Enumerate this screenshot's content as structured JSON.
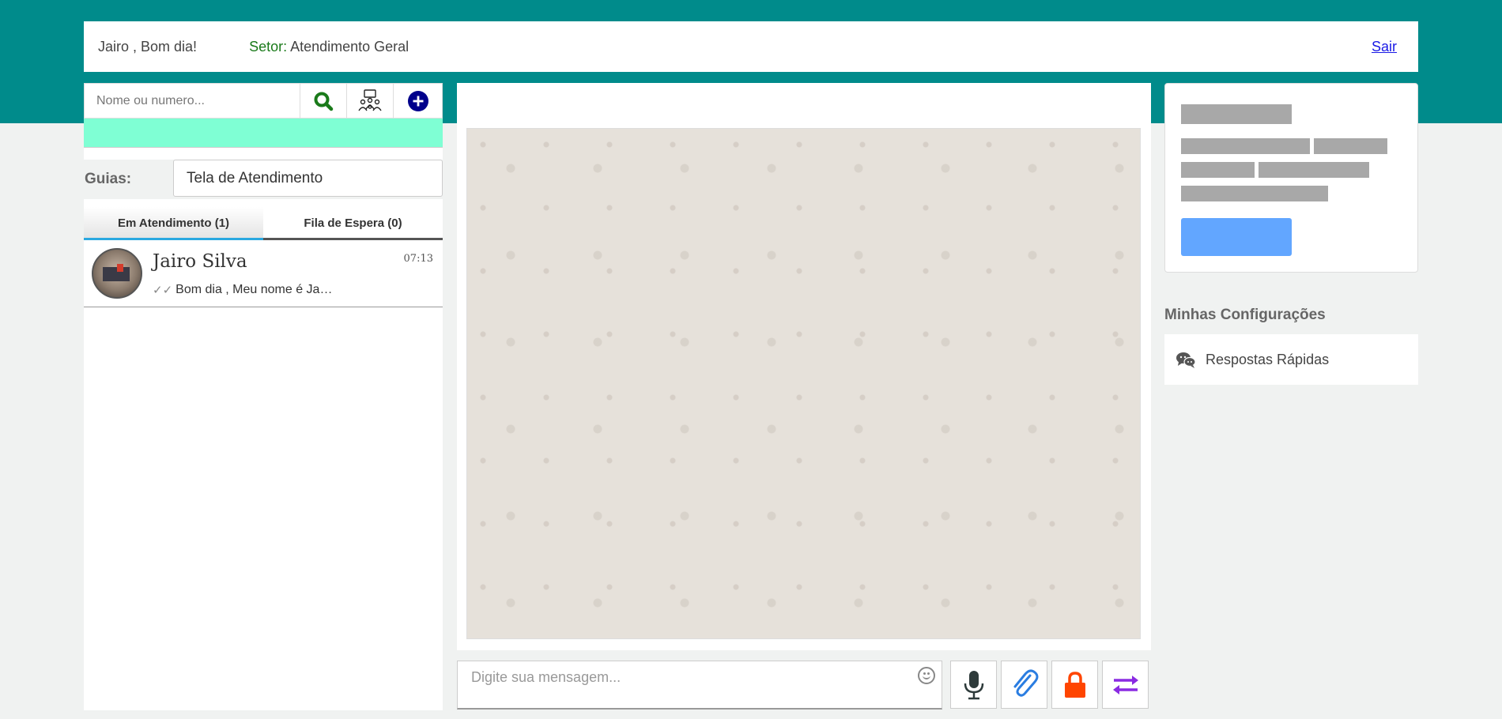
{
  "header": {
    "greeting": "Jairo , Bom dia!",
    "setor_label": "Setor:",
    "setor_value": " Atendimento Geral",
    "logout_label": "Sair"
  },
  "search": {
    "placeholder": "Nome ou numero...",
    "icons": [
      "search-icon",
      "group-icon",
      "add-icon"
    ]
  },
  "guias": {
    "label": "Guias:",
    "selected": "Tela de Atendimento"
  },
  "tabs": [
    {
      "label": "Em Atendimento (1)",
      "active": true
    },
    {
      "label": "Fila de Espera (0)",
      "active": false
    }
  ],
  "chats": [
    {
      "name": "Jairo Silva",
      "time": "07:13",
      "ticks": "✓✓",
      "preview": "Bom dia , Meu nome é Ja…"
    }
  ],
  "composer": {
    "placeholder": "Digite sua mensagem...",
    "actions": [
      "microphone-icon",
      "paperclip-icon",
      "lock-icon",
      "transfer-icon"
    ]
  },
  "sidebar_right": {
    "config_title": "Minhas Configurações",
    "config_items": [
      {
        "label": "Respostas Rápidas",
        "icon": "chat-bubbles-icon"
      }
    ]
  },
  "colors": {
    "brand": "#008b8b",
    "notice": "#7fffd4",
    "tab_active": "#29a8e0",
    "primary_button": "#62a6ff",
    "lock": "#ff4500",
    "transfer": "#8a2be2",
    "add": "#00008b",
    "search": "#1a7a1a"
  }
}
